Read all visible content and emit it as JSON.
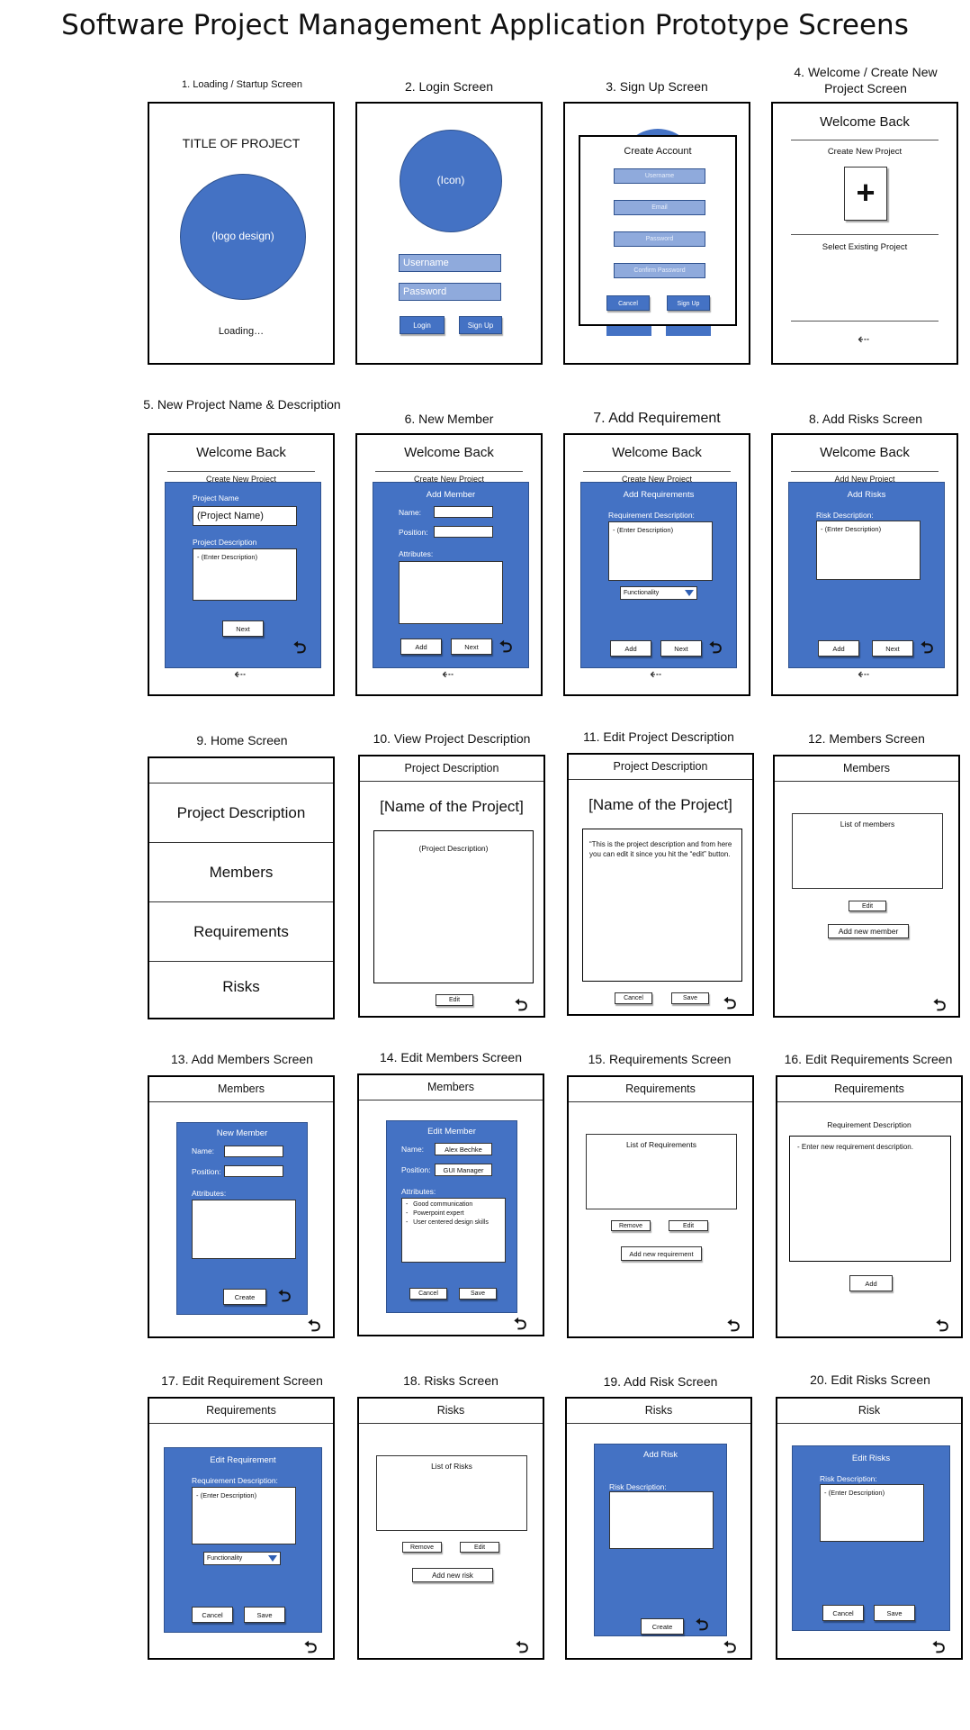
{
  "page_title": "Software Project Management Application Prototype Screens",
  "captions": [
    "1. Loading / Startup Screen",
    "2. Login Screen",
    "3. Sign Up Screen",
    "4. Welcome / Create New Project Screen",
    "5. New Project Name & Description",
    "6. New Member",
    "7. Add Requirement",
    "8. Add Risks Screen",
    "9. Home Screen",
    "10. View Project Description",
    "11. Edit Project Description",
    "12. Members Screen",
    "13. Add Members Screen",
    "14. Edit Members Screen",
    "15. Requirements Screen",
    "16. Edit Requirements Screen",
    "17. Edit Requirement Screen",
    "18. Risks Screen",
    "19. Add Risk Screen",
    "20. Edit Risks Screen"
  ],
  "s1": {
    "title": "TITLE OF PROJECT",
    "logo": "(logo design)",
    "loading": "Loading…"
  },
  "s2": {
    "icon": "(Icon)",
    "username": "Username",
    "password": "Password",
    "login": "Login",
    "signup": "Sign Up"
  },
  "s3": {
    "title": "Create Account",
    "username": "Username",
    "email": "Email",
    "password": "Password",
    "confirm": "Confirm Password",
    "cancel": "Cancel",
    "signup": "Sign Up"
  },
  "s4": {
    "welcome": "Welcome Back",
    "create": "Create New Project",
    "plus": "+",
    "select": "Select Existing Project"
  },
  "s5": {
    "welcome": "Welcome Back",
    "peek": "Create New Project",
    "name_label": "Project Name",
    "name_value": "(Project Name)",
    "desc_label": "Project Description",
    "desc_value": "- (Enter Description)",
    "next": "Next"
  },
  "s6": {
    "welcome": "Welcome Back",
    "peek": "Create New Project",
    "title": "Add Member",
    "name": "Name:",
    "position": "Position:",
    "attributes": "Attributes:",
    "add": "Add",
    "next": "Next"
  },
  "s7": {
    "welcome": "Welcome Back",
    "peek": "Create New Project",
    "title": "Add Requirements",
    "req_label": "Requirement  Description:",
    "desc": "- (Enter Description)",
    "dropdown": "Functionality",
    "add": "Add",
    "next": "Next"
  },
  "s8": {
    "welcome": "Welcome Back",
    "peek": "Add New Project",
    "title": "Add Risks",
    "risk_label": "Risk Description:",
    "desc": "- (Enter Description)",
    "add": "Add",
    "next": "Next"
  },
  "s9": {
    "rows": [
      "Project Description",
      "Members",
      "Requirements",
      "Risks"
    ]
  },
  "s10": {
    "header": "Project Description",
    "name": "[Name of the Project]",
    "desc": "(Project Description)",
    "edit": "Edit"
  },
  "s11": {
    "header": "Project Description",
    "name": "[Name of the Project]",
    "desc": "“This is the project description and from here you can edit it since you hit the “edit” button.",
    "cancel": "Cancel",
    "save": "Save"
  },
  "s12": {
    "header": "Members",
    "list": "List of members",
    "edit": "Edit",
    "add": "Add new member"
  },
  "s13": {
    "header": "Members",
    "title": "New Member",
    "name": "Name:",
    "position": "Position:",
    "attributes": "Attributes:",
    "create": "Create"
  },
  "s14": {
    "header": "Members",
    "title": "Edit Member",
    "name": "Name:",
    "name_value": "Alex Bechke",
    "position": "Position:",
    "position_value": "GUI Manager",
    "attributes": "Attributes:",
    "attr_items": [
      "Good communication",
      "Powerpoint expert",
      "User centered design skills"
    ],
    "cancel": "Cancel",
    "save": "Save"
  },
  "s15": {
    "header": "Requirements",
    "list": "List of Requirements",
    "remove": "Remove",
    "edit": "Edit",
    "add": "Add new requirement"
  },
  "s16": {
    "header": "Requirements",
    "label": "Requirement Description",
    "desc": "- Enter new requirement description.",
    "add": "Add"
  },
  "s17": {
    "header": "Requirements",
    "title": "Edit Requirement",
    "req_label": "Requirement  Description:",
    "desc": "- (Enter Description)",
    "dropdown": "Functionality",
    "cancel": "Cancel",
    "save": "Save"
  },
  "s18": {
    "header": "Risks",
    "list": "List of Risks",
    "remove": "Remove",
    "edit": "Edit",
    "add": "Add new risk"
  },
  "s19": {
    "header": "Risks",
    "title": "Add Risk",
    "risk_label": "Risk Description:",
    "create": "Create"
  },
  "s20": {
    "header": "Risk",
    "title": "Edit Risks",
    "risk_label": "Risk Description:",
    "desc": "- (Enter Description)",
    "cancel": "Cancel",
    "save": "Save"
  },
  "icons": {
    "back": "↩ (back-arrow-icon)",
    "exit": "exit-door-icon"
  },
  "colors": {
    "accent": "#4472c4",
    "field": "#8faadc",
    "border": "#2f528f"
  }
}
